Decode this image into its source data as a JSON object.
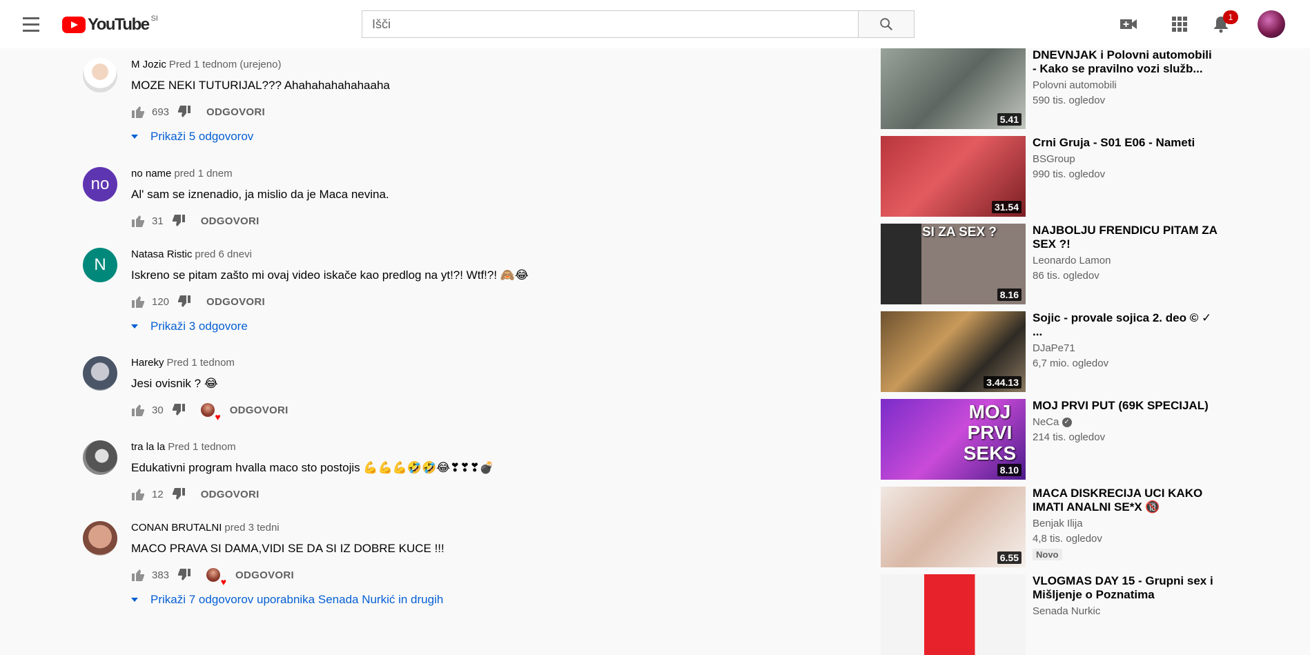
{
  "masthead": {
    "logo_text": "YouTube",
    "country_code": "SI",
    "search_placeholder": "Išči",
    "notification_count": "1"
  },
  "comments": [
    {
      "author": "M Jozic",
      "time": "Pred 1 tednom (urejeno)",
      "text": "MOZE NEKI TUTURIJAL??? Ahahahahahahaaha",
      "likes": "693",
      "reply_label": "ODGOVORI",
      "creator_heart": false,
      "replies_label": "Prikaži 5 odgovorov"
    },
    {
      "author": "no name",
      "time": "pred 1 dnem",
      "text": "Al' sam se iznenadio, ja mislio da je Maca nevina.",
      "likes": "31",
      "reply_label": "ODGOVORI",
      "creator_heart": false,
      "avatar_letter": "no",
      "avatar_color": "#5e35b1"
    },
    {
      "author": "Natasa Ristic",
      "time": "pred 6 dnevi",
      "text": "Iskreno se pitam zašto mi ovaj video iskače kao predlog na yt!?! Wtf!?! 🙈😂",
      "likes": "120",
      "reply_label": "ODGOVORI",
      "creator_heart": false,
      "avatar_letter": "N",
      "avatar_color": "#00897b",
      "replies_label": "Prikaži 3 odgovore"
    },
    {
      "author": "Hareky",
      "time": "Pred 1 tednom",
      "text": "Jesi ovisnik ? 😂",
      "likes": "30",
      "reply_label": "ODGOVORI",
      "creator_heart": true
    },
    {
      "author": "tra la la",
      "time": "Pred 1 tednom",
      "text": "Edukativni program hvalla maco sto postojis 💪💪💪🤣🤣😂❣❣❣💣",
      "likes": "12",
      "reply_label": "ODGOVORI",
      "creator_heart": false
    },
    {
      "author": "CONAN BRUTALNI",
      "time": "pred 3 tedni",
      "text": "MACO PRAVA SI DAMA,VIDI  SE DA SI IZ DOBRE KUCE !!!",
      "likes": "383",
      "reply_label": "ODGOVORI",
      "creator_heart": true,
      "replies_label": "Prikaži 7 odgovorov uporabnika Senada Nurkić in drugih"
    }
  ],
  "sidebar": [
    {
      "title": "DNEVNJAK i Polovni automobili - Kako se pravilno vozi služb...",
      "channel": "Polovni automobili",
      "views": "590 tis. ogledov",
      "duration": "5.41"
    },
    {
      "title": "Crni Gruja - S01 E06 - Nameti",
      "channel": "BSGroup",
      "views": "990 tis. ogledov",
      "duration": "31.54"
    },
    {
      "title": "NAJBOLJU FRENDICU PITAM ZA SEX ?!",
      "channel": "Leonardo Lamon",
      "views": "86 tis. ogledov",
      "duration": "8.16",
      "thumb_text": "SI ZA SEX ?"
    },
    {
      "title": "Sojic - provale sojica 2. deo © ✓ ...",
      "channel": "DJaPe71",
      "views": "6,7 mio. ogledov",
      "duration": "3.44.13"
    },
    {
      "title": "MOJ PRVI PUT (69K SPECIJAL)",
      "channel": "NeCa",
      "verified": true,
      "views": "214 tis. ogledov",
      "duration": "8.10",
      "thumb_text": "MOJ PRVI SEKS"
    },
    {
      "title": "MACA DISKRECIJA UCI KAKO IMATI ANALNI SE*X 🔞",
      "channel": "Benjak Ilija",
      "views": "4,8 tis. ogledov",
      "duration": "6.55",
      "badge": "Novo"
    },
    {
      "title": "VLOGMAS DAY 15 - Grupni sex i Mišljenje o Poznatima",
      "channel": "Senada Nurkic",
      "views": "",
      "duration": ""
    }
  ]
}
